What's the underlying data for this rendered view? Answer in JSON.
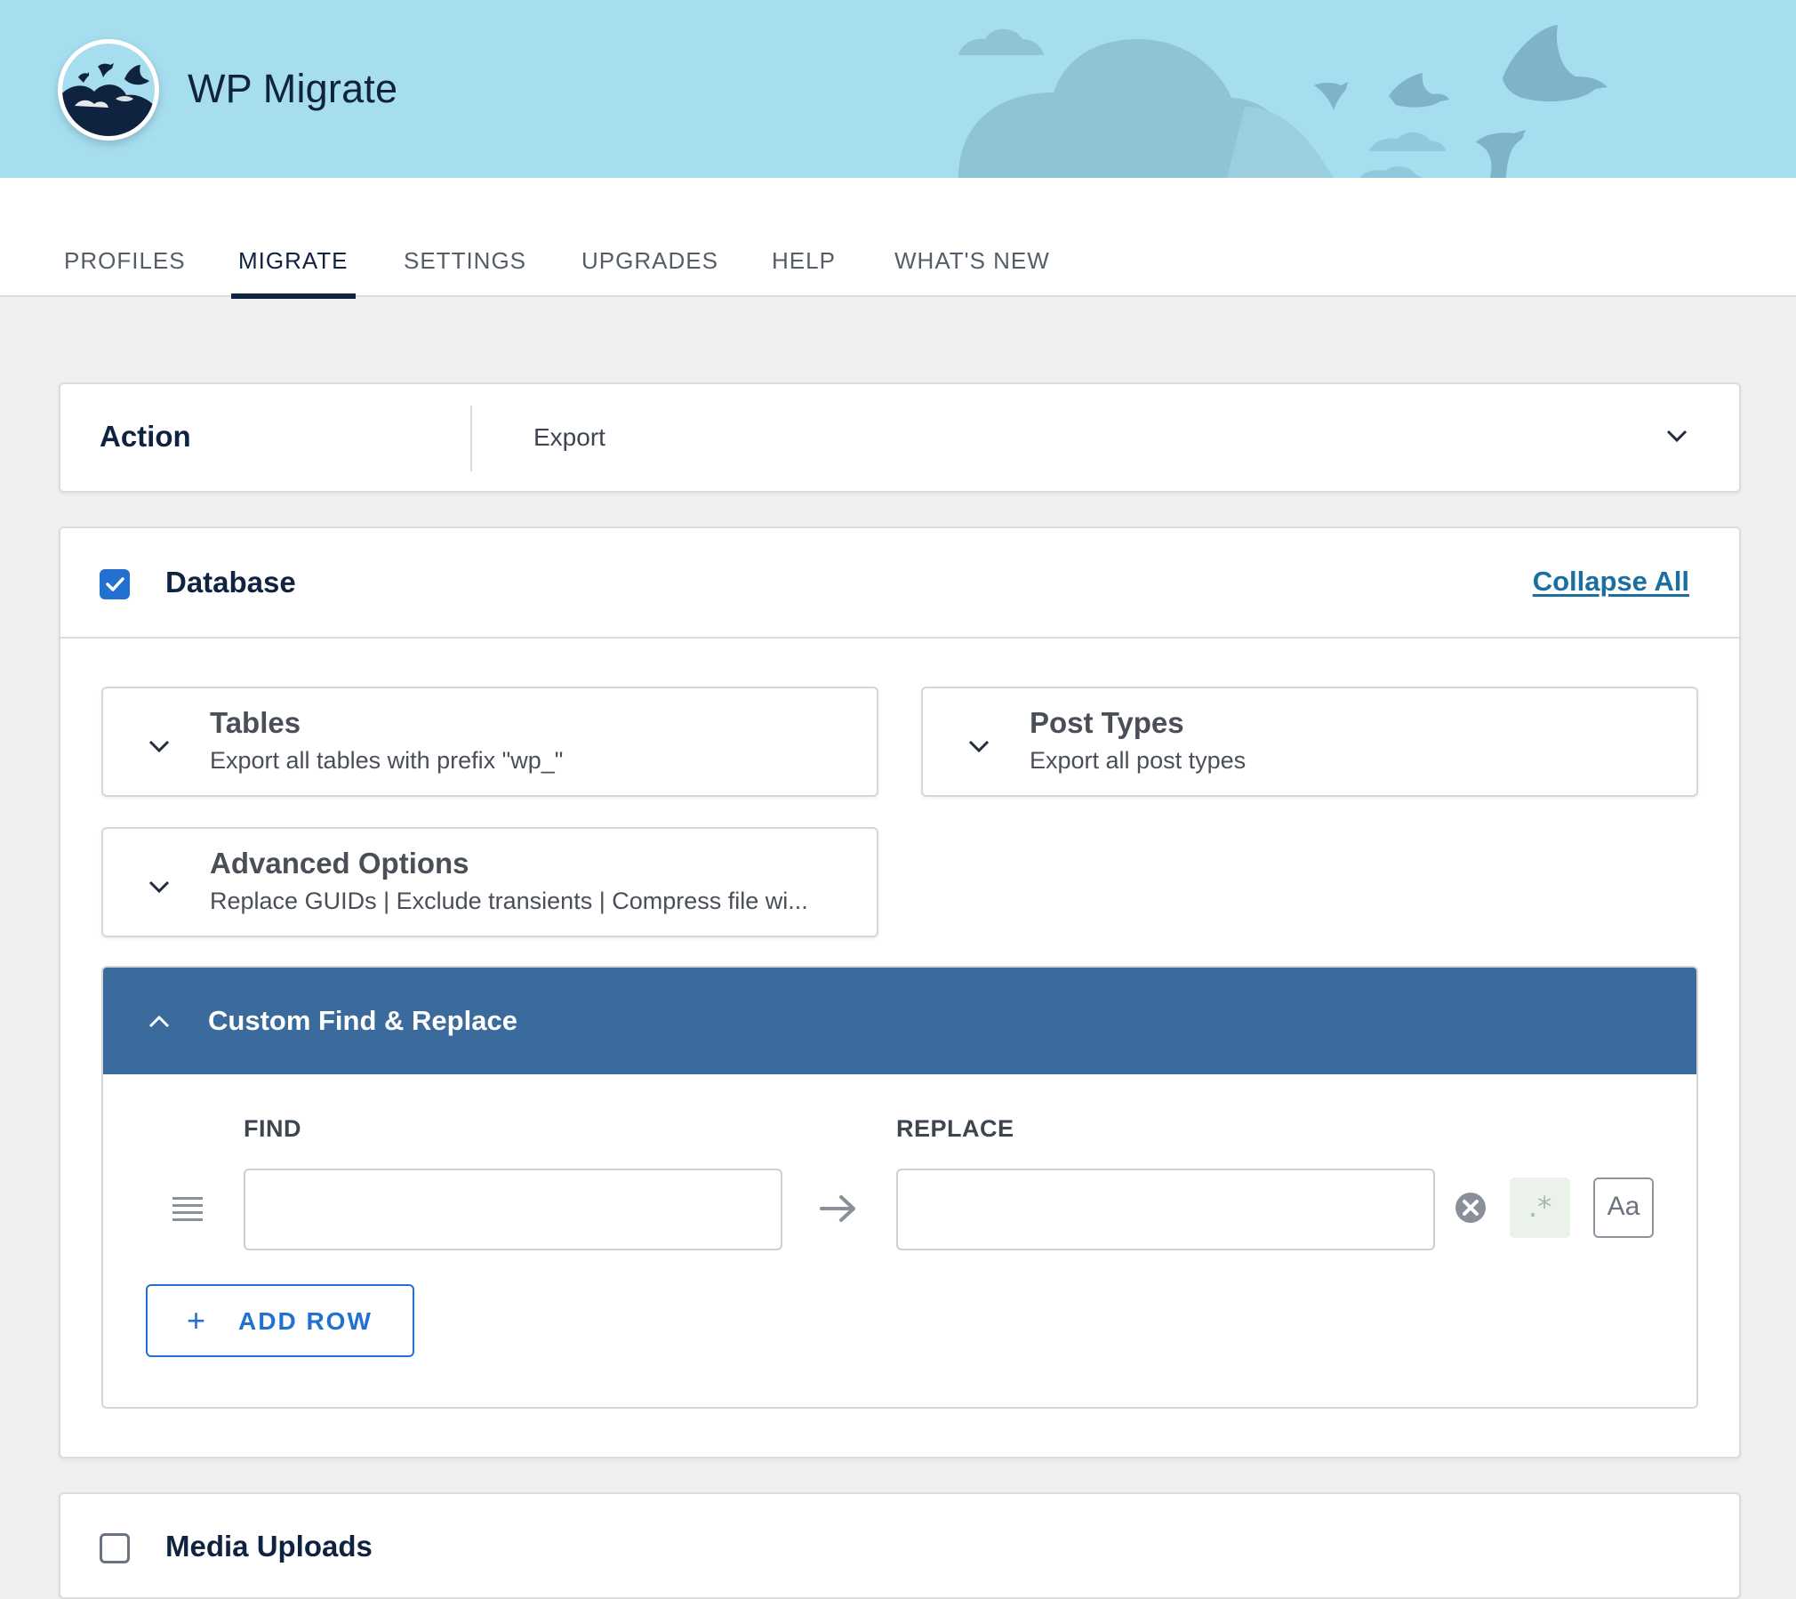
{
  "app": {
    "title": "WP Migrate"
  },
  "colors": {
    "header_bg": "#a6def0",
    "accent": "#2271d1",
    "panel_header": "#3a6b9c",
    "brand_dark": "#0f2340"
  },
  "nav": {
    "tabs": [
      {
        "label": "PROFILES",
        "active": false
      },
      {
        "label": "MIGRATE",
        "active": true
      },
      {
        "label": "SETTINGS",
        "active": false
      },
      {
        "label": "UPGRADES",
        "active": false
      },
      {
        "label": "HELP",
        "active": false
      },
      {
        "label": "WHAT'S NEW",
        "active": false
      }
    ]
  },
  "action": {
    "label": "Action",
    "value": "Export",
    "icon": "chevron-down-icon"
  },
  "database": {
    "checked": true,
    "title": "Database",
    "collapse_all": "Collapse All",
    "panels": {
      "tables": {
        "title": "Tables",
        "summary": "Export all tables with prefix \"wp_\""
      },
      "post_types": {
        "title": "Post Types",
        "summary": "Export all post types"
      },
      "advanced": {
        "title": "Advanced Options",
        "summary": "Replace GUIDs | Exclude transients | Compress file wi..."
      }
    },
    "find_replace": {
      "title": "Custom Find & Replace",
      "find_label": "FIND",
      "replace_label": "REPLACE",
      "find_value": "",
      "replace_value": "",
      "regex_label": ".*",
      "case_label": "Aa",
      "add_row_plus": "+",
      "add_row_label": "ADD ROW"
    }
  },
  "media": {
    "checked": false,
    "title": "Media Uploads"
  }
}
